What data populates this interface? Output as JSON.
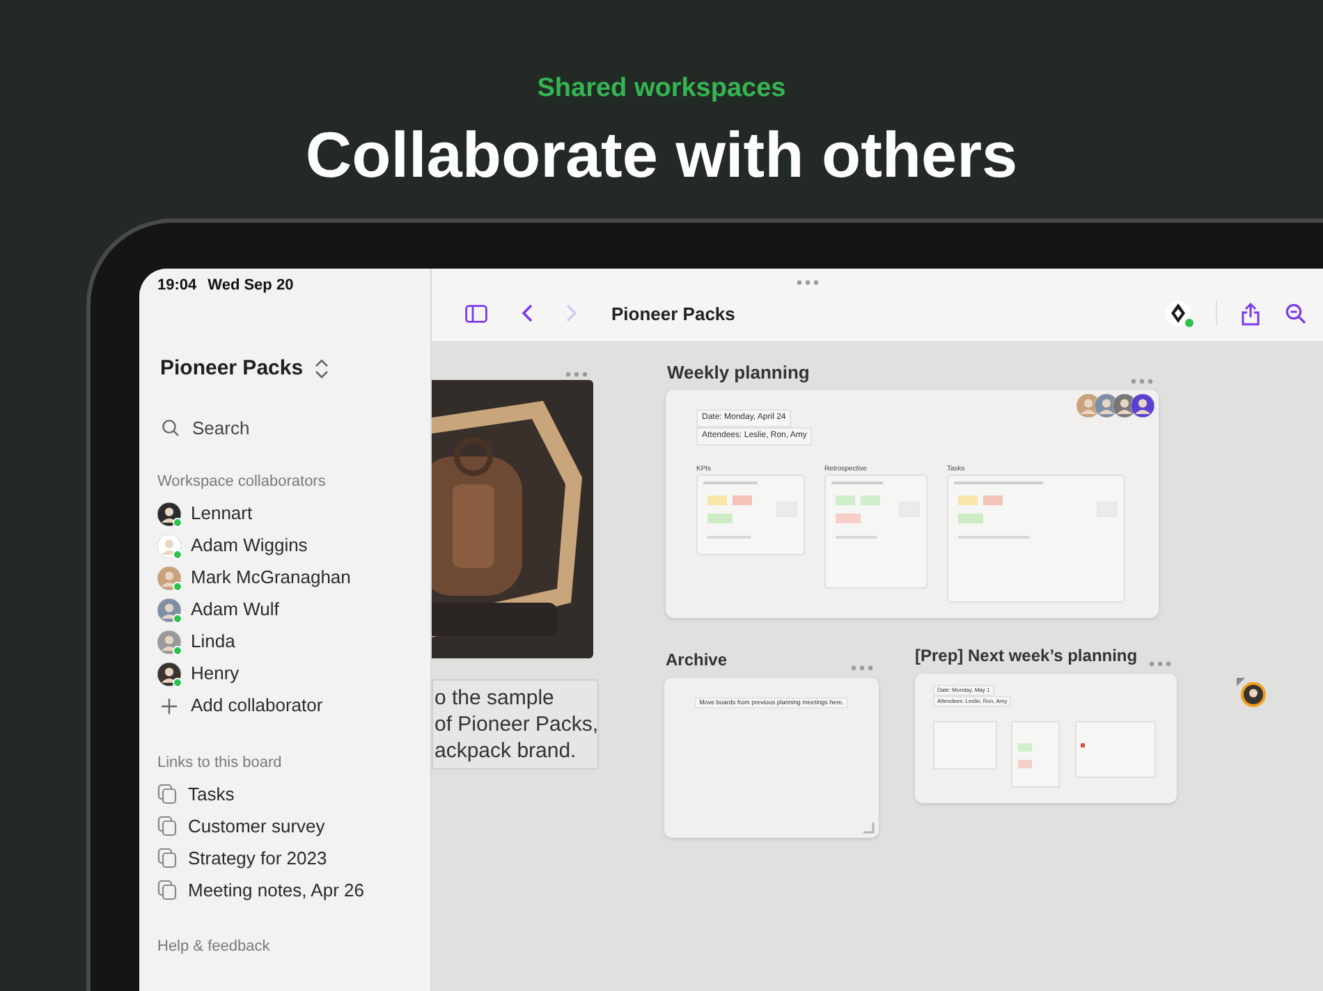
{
  "header": {
    "eyebrow": "Shared workspaces",
    "title": "Collaborate with others"
  },
  "status_bar": {
    "time": "19:04",
    "date": "Wed Sep 20"
  },
  "sidebar": {
    "workspace": "Pioneer Packs",
    "search": {
      "placeholder": "Search"
    },
    "sections": [
      {
        "title": "Workspace collaborators",
        "items": [
          {
            "kind": "person",
            "label": "Lennart",
            "online": true,
            "color": "#2b2b2b"
          },
          {
            "kind": "person",
            "label": "Adam Wiggins",
            "online": true,
            "color": "#ffffff"
          },
          {
            "kind": "person",
            "label": "Mark McGranaghan",
            "online": true,
            "color": "#c9a27a"
          },
          {
            "kind": "person",
            "label": "Adam Wulf",
            "online": true,
            "color": "#7f8fa6"
          },
          {
            "kind": "person",
            "label": "Linda",
            "online": true,
            "color": "#9a9a9a"
          },
          {
            "kind": "person",
            "label": "Henry",
            "online": true,
            "color": "#3b3330"
          },
          {
            "kind": "add",
            "label": "Add collaborator"
          }
        ]
      },
      {
        "title": "Links to this board",
        "items": [
          {
            "kind": "link",
            "label": "Tasks"
          },
          {
            "kind": "link",
            "label": "Customer survey"
          },
          {
            "kind": "link",
            "label": "Strategy for 2023"
          },
          {
            "kind": "link",
            "label": "Meeting notes, Apr 26"
          }
        ]
      },
      {
        "title": "Help & feedback"
      }
    ]
  },
  "toolbar": {
    "title": "Pioneer Packs",
    "forward_disabled": true
  },
  "canvas": {
    "items": [
      {
        "kind": "picture"
      },
      {
        "kind": "text",
        "lines": [
          "o the sample",
          "of Pioneer Packs,",
          "ackpack brand."
        ]
      },
      {
        "kind": "board",
        "title": "Weekly planning",
        "fields": [
          "Date: Monday, April 24",
          "Attendees: Leslie, Ron, Amy"
        ],
        "sections": [
          "KPIs",
          "Retrospective",
          "Tasks"
        ],
        "avatars": [
          {
            "color": "#c9a27a"
          },
          {
            "color": "#7f8fa6"
          },
          {
            "color": "#777777"
          },
          {
            "color": "#5b3fd1"
          }
        ]
      },
      {
        "kind": "note",
        "title": "Archive",
        "note": "Move boards from previous planning meetings here."
      },
      {
        "kind": "board",
        "title": "[Prep] Next week’s planning",
        "fields": [
          "Date: Monday, May 1",
          "Attendees: Leslie, Ron, Amy"
        ]
      },
      {
        "kind": "cursor",
        "color": "#f0a020"
      }
    ]
  }
}
